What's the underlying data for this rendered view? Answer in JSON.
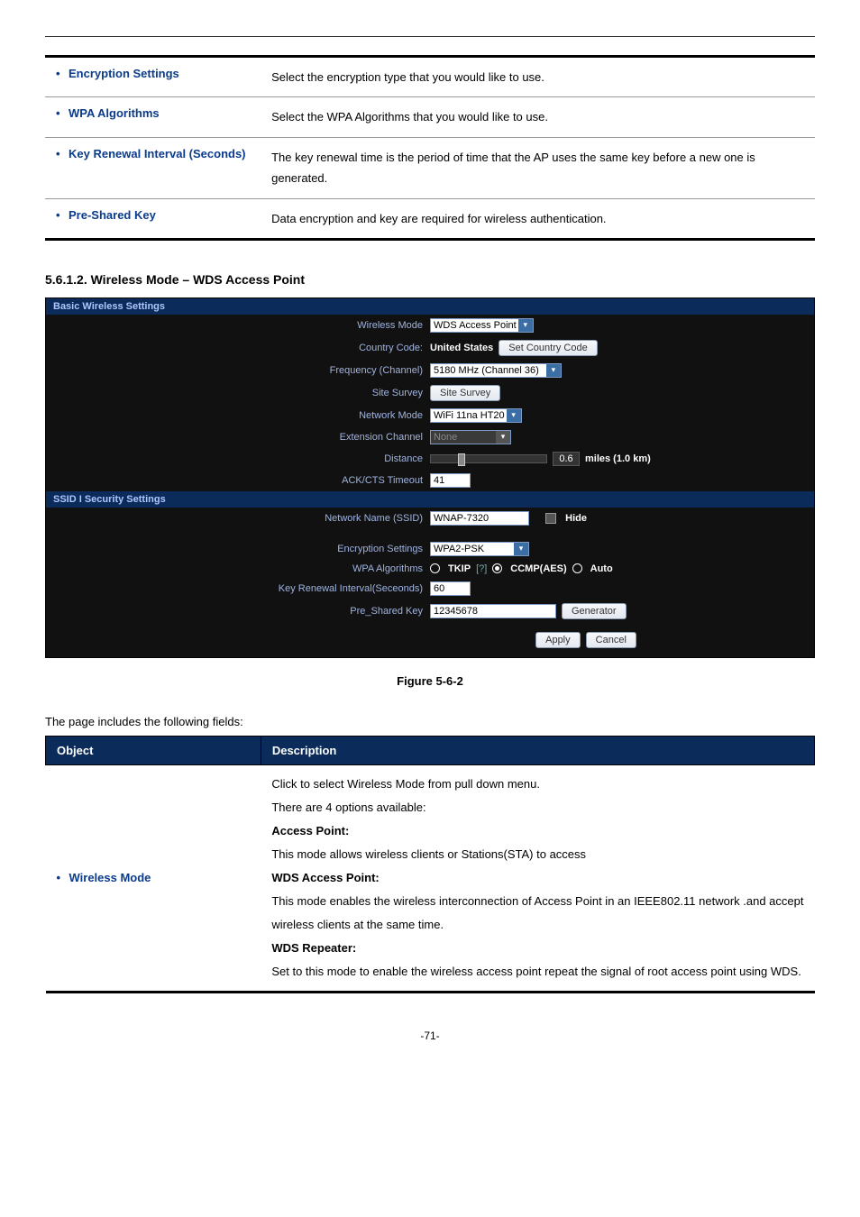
{
  "top_table": {
    "rows": [
      {
        "label": "Encryption Settings",
        "desc": "Select the encryption type that you would like to use."
      },
      {
        "label": "WPA Algorithms",
        "desc": "Select the WPA Algorithms that you would like to use."
      },
      {
        "label": "Key Renewal Interval (Seconds)",
        "desc": "The key renewal time is the period of time that the AP uses the same key before a new one is generated."
      },
      {
        "label": "Pre-Shared Key",
        "desc": "Data encryption and key are required for wireless authentication."
      }
    ]
  },
  "section_heading": "5.6.1.2.  Wireless Mode – WDS Access Point",
  "panel": {
    "basic_header": "Basic Wireless Settings",
    "ssid_header": "SSID I Security Settings",
    "labels": {
      "wireless_mode": "Wireless Mode",
      "country_code": "Country Code:",
      "frequency": "Frequency (Channel)",
      "site_survey": "Site Survey",
      "network_mode": "Network Mode",
      "extension_channel": "Extension Channel",
      "distance": "Distance",
      "ack_timeout": "ACK/CTS Timeout",
      "network_name": "Network Name (SSID)",
      "encryption_settings": "Encryption Settings",
      "wpa_algorithms": "WPA Algorithms",
      "key_renewal": "Key Renewal Interval(Seceonds)",
      "pre_shared_key": "Pre_Shared Key"
    },
    "values": {
      "wireless_mode": "WDS Access Point",
      "country_code_value": "United States",
      "set_country_btn": "Set Country Code",
      "frequency": "5180 MHz (Channel 36)",
      "site_survey_btn": "Site Survey",
      "network_mode": "WiFi 11na HT20",
      "extension_channel": "None",
      "distance_value": "0.6",
      "distance_unit": "miles (1.0 km)",
      "ack_timeout": "41",
      "network_name": "WNAP-7320",
      "hide_label": "Hide",
      "encryption_settings": "WPA2-PSK",
      "wpa_tkip": "TKIP",
      "wpa_ccmp": "CCMP(AES)",
      "wpa_auto": "Auto",
      "tkip_help": "[?]",
      "key_renewal": "60",
      "pre_shared_key": "12345678",
      "generator_btn": "Generator",
      "apply_btn": "Apply",
      "cancel_btn": "Cancel"
    }
  },
  "figure_caption": "Figure 5-6-2",
  "fields_intro": "The page includes the following fields:",
  "obj_table": {
    "headers": {
      "object": "Object",
      "description": "Description"
    },
    "row": {
      "label": "Wireless Mode",
      "desc_l1": "Click to select Wireless Mode from pull down menu.",
      "desc_l2": "There are 4 options available:",
      "ap_title": "Access Point:",
      "ap_desc": "This mode allows wireless clients or Stations(STA) to access",
      "wds_ap_title": "WDS Access Point:",
      "wds_ap_desc": "This mode enables the wireless interconnection of Access Point in an IEEE802.11 network .and accept wireless clients at the same time.",
      "wds_rep_title": "WDS Repeater:",
      "wds_rep_desc": "Set to this mode to enable the wireless access point repeat the signal of root access point using WDS."
    }
  },
  "page_number": "-71-"
}
